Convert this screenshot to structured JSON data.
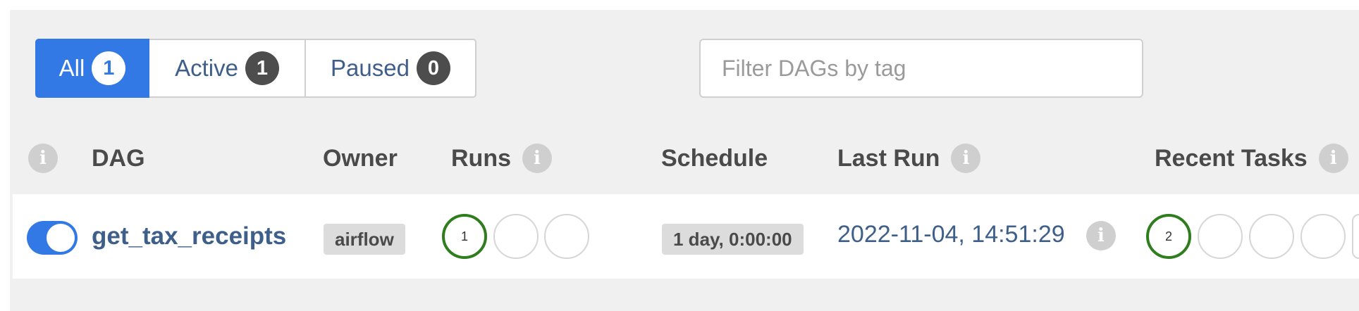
{
  "filters": {
    "all": {
      "label": "All",
      "count": "1"
    },
    "active": {
      "label": "Active",
      "count": "1"
    },
    "paused": {
      "label": "Paused",
      "count": "0"
    }
  },
  "tag_filter": {
    "placeholder": "Filter DAGs by tag",
    "value": ""
  },
  "columns": {
    "dag": "DAG",
    "owner": "Owner",
    "runs": "Runs",
    "schedule": "Schedule",
    "last_run": "Last Run",
    "recent_tasks": "Recent Tasks"
  },
  "icons": {
    "info": "i"
  },
  "rows": [
    {
      "paused": false,
      "dag_id": "get_tax_receipts",
      "owner": "airflow",
      "runs": [
        "1",
        "",
        ""
      ],
      "schedule": "1 day, 0:00:00",
      "last_run": "2022-11-04, 14:51:29",
      "recent_tasks": [
        "2",
        "",
        "",
        "",
        ""
      ]
    }
  ],
  "colors": {
    "primary": "#3379e5",
    "link": "#3e5f8a",
    "success": "#2f7d1f"
  }
}
